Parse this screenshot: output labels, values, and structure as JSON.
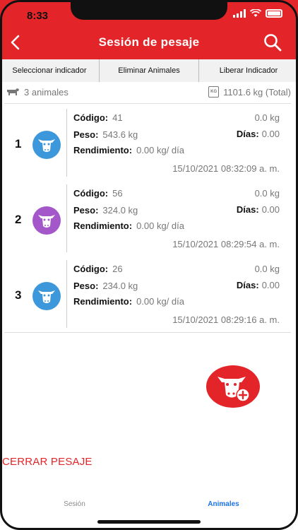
{
  "status_bar": {
    "time": "8:33"
  },
  "header": {
    "title": "Sesión de pesaje",
    "accent": "#e3252a"
  },
  "actions": [
    {
      "label": "Seleccionar indicador"
    },
    {
      "label": "Eliminar Animales"
    },
    {
      "label": "Liberar Indicador"
    }
  ],
  "summary": {
    "animals": "3 animales",
    "total": "1101.6 kg (Total)"
  },
  "labels": {
    "codigo": "Código:",
    "peso": "Peso:",
    "rendimiento": "Rendimiento:",
    "dias": "Días:"
  },
  "animals": [
    {
      "index": "1",
      "color": "#3d98db",
      "codigo": "41",
      "peso": "543.6 kg",
      "rendimiento": "0.00 kg/ día",
      "weight_right": "0.0 kg",
      "dias": "0.00",
      "date": "15/10/2021 08:32:09 a. m."
    },
    {
      "index": "2",
      "color": "#a357c9",
      "codigo": "56",
      "peso": "324.0 kg",
      "rendimiento": "0.00 kg/ día",
      "weight_right": "0.0 kg",
      "dias": "0.00",
      "date": "15/10/2021 08:29:54 a. m."
    },
    {
      "index": "3",
      "color": "#3d98db",
      "codigo": "26",
      "peso": "234.0 kg",
      "rendimiento": "0.00 kg/ día",
      "weight_right": "0.0 kg",
      "dias": "0.00",
      "date": "15/10/2021 08:29:16 a. m."
    }
  ],
  "close_button": "CERRAR PESAJE",
  "tabs": [
    {
      "label": "Sesión",
      "active": false
    },
    {
      "label": "Animales",
      "active": true
    }
  ],
  "icons": {
    "back": "chevron-left-icon",
    "search": "search-icon",
    "cow": "cow-icon",
    "add_animal": "cow-add-icon",
    "herd": "cow-silhouette-icon",
    "scale": "kg-weight-icon"
  }
}
